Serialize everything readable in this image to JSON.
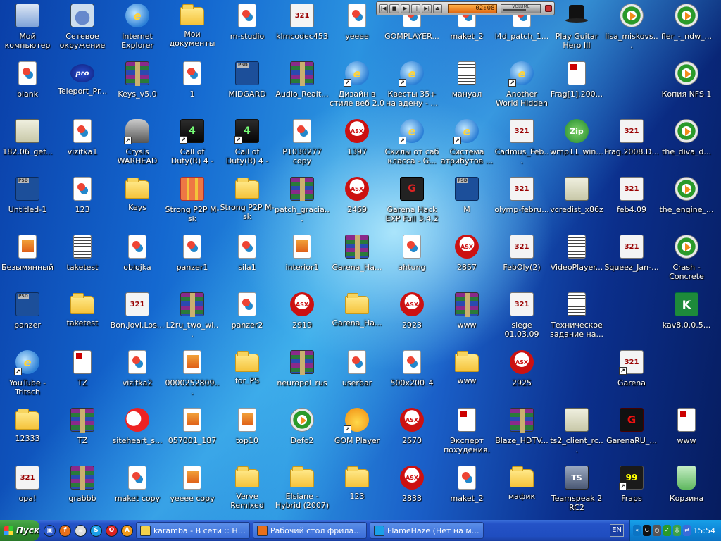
{
  "desktop": {
    "icons": [
      {
        "label": "Мой компьютер",
        "glyph": "computer",
        "icon": "my-computer-icon",
        "col": 0,
        "row": 0
      },
      {
        "label": "blank",
        "glyph": "image",
        "icon": "image-file-icon",
        "col": 0,
        "row": 1
      },
      {
        "label": "182.06_gef...",
        "glyph": "exe",
        "icon": "installer-icon",
        "col": 0,
        "row": 2
      },
      {
        "label": "Untitled-1",
        "glyph": "psd",
        "icon": "photoshop-file-icon",
        "col": 0,
        "row": 3
      },
      {
        "label": "Безымянный",
        "glyph": "photo",
        "icon": "photo-file-icon",
        "col": 0,
        "row": 4
      },
      {
        "label": "panzer",
        "glyph": "psd",
        "icon": "photoshop-file-icon",
        "col": 0,
        "row": 5
      },
      {
        "label": "YouTube - Tritsch Tratsch",
        "glyph": "web",
        "glyph_text": "e",
        "shortcut": true,
        "icon": "internet-shortcut-icon",
        "col": 0,
        "row": 6
      },
      {
        "label": "12333",
        "glyph": "folder",
        "icon": "folder-icon",
        "col": 0,
        "row": 7
      },
      {
        "label": "opa!",
        "glyph": "mpc",
        "glyph_text": "321",
        "icon": "video-file-icon",
        "col": 0,
        "row": 8
      },
      {
        "label": "Сетевое окружение",
        "glyph": "network",
        "icon": "network-places-icon",
        "col": 1,
        "row": 0
      },
      {
        "label": "Teleport_Pr...",
        "glyph": "pro",
        "glyph_text": "pro",
        "icon": "teleport-pro-icon",
        "col": 1,
        "row": 1
      },
      {
        "label": "vizitka1",
        "glyph": "image",
        "icon": "image-file-icon",
        "col": 1,
        "row": 2
      },
      {
        "label": "123",
        "glyph": "image",
        "icon": "image-file-icon",
        "col": 1,
        "row": 3
      },
      {
        "label": "taketest",
        "glyph": "text",
        "icon": "text-file-icon",
        "col": 1,
        "row": 4
      },
      {
        "label": "taketest",
        "glyph": "folder",
        "icon": "folder-icon",
        "col": 1,
        "row": 5
      },
      {
        "label": "TZ",
        "glyph": "doc",
        "icon": "document-file-icon",
        "col": 1,
        "row": 6
      },
      {
        "label": "TZ",
        "glyph": "rar",
        "icon": "rar-archive-icon",
        "col": 1,
        "row": 7
      },
      {
        "label": "grabbb",
        "glyph": "rar",
        "icon": "rar-archive-icon",
        "col": 1,
        "row": 8
      },
      {
        "label": "Internet Explorer",
        "glyph": "web",
        "glyph_text": "e",
        "icon": "internet-explorer-icon",
        "col": 2,
        "row": 0
      },
      {
        "label": "Keys_v5.0",
        "glyph": "rar",
        "icon": "rar-archive-icon",
        "col": 2,
        "row": 1
      },
      {
        "label": "Crysis WARHEAD",
        "glyph": "soldier",
        "shortcut": true,
        "icon": "game-shortcut-icon",
        "col": 2,
        "row": 2
      },
      {
        "label": "Keys",
        "glyph": "folder",
        "icon": "folder-icon",
        "col": 2,
        "row": 3
      },
      {
        "label": "oblojka",
        "glyph": "image",
        "icon": "image-file-icon",
        "col": 2,
        "row": 4
      },
      {
        "label": "Bon.Jovi.Los...",
        "glyph": "mpc",
        "glyph_text": "321",
        "icon": "video-file-icon",
        "col": 2,
        "row": 5
      },
      {
        "label": "vizitka2",
        "glyph": "image",
        "icon": "image-file-icon",
        "col": 2,
        "row": 6
      },
      {
        "label": "siteheart_s...",
        "glyph": "heart",
        "icon": "siteheart-icon",
        "col": 2,
        "row": 7
      },
      {
        "label": "maket copy",
        "glyph": "image",
        "icon": "image-file-icon",
        "col": 2,
        "row": 8
      },
      {
        "label": "Мои документы",
        "glyph": "folder",
        "icon": "my-documents-icon",
        "col": 3,
        "row": 0
      },
      {
        "label": "1",
        "glyph": "image",
        "icon": "image-file-icon",
        "col": 3,
        "row": 1
      },
      {
        "label": "Call of Duty(R) 4 - Modern ...",
        "glyph": "game",
        "glyph_text": "4",
        "shortcut": true,
        "icon": "game-shortcut-icon",
        "col": 3,
        "row": 2
      },
      {
        "label": "Strong P2P M-sk",
        "glyph": "gift",
        "icon": "strong-p2p-icon",
        "col": 3,
        "row": 3
      },
      {
        "label": "panzer1",
        "glyph": "image",
        "icon": "image-file-icon",
        "col": 3,
        "row": 4
      },
      {
        "label": "L2ru_two_wi...",
        "glyph": "rar",
        "icon": "rar-archive-icon",
        "col": 3,
        "row": 5
      },
      {
        "label": "0000252809...",
        "glyph": "photo",
        "icon": "photo-file-icon",
        "col": 3,
        "row": 6
      },
      {
        "label": "057001_187",
        "glyph": "photo",
        "icon": "photo-file-icon",
        "col": 3,
        "row": 7
      },
      {
        "label": "yeeee copy",
        "glyph": "photo",
        "icon": "photo-file-icon",
        "col": 3,
        "row": 8
      },
      {
        "label": "m-studio",
        "glyph": "image",
        "icon": "image-file-icon",
        "col": 4,
        "row": 0
      },
      {
        "label": "MIDGARD",
        "glyph": "psd",
        "icon": "photoshop-file-icon",
        "col": 4,
        "row": 1
      },
      {
        "label": "Call of Duty(R) 4 - Modern ...",
        "glyph": "game",
        "glyph_text": "4",
        "shortcut": true,
        "icon": "game-shortcut-icon",
        "col": 4,
        "row": 2
      },
      {
        "label": "Strong P2P M-sk",
        "glyph": "folder",
        "icon": "folder-icon",
        "col": 4,
        "row": 3
      },
      {
        "label": "sila1",
        "glyph": "image",
        "icon": "image-file-icon",
        "col": 4,
        "row": 4
      },
      {
        "label": "panzer2",
        "glyph": "image",
        "icon": "image-file-icon",
        "col": 4,
        "row": 5
      },
      {
        "label": "for_PS",
        "glyph": "folder",
        "icon": "folder-icon",
        "col": 4,
        "row": 6
      },
      {
        "label": "top10",
        "glyph": "photo",
        "icon": "photo-file-icon",
        "col": 4,
        "row": 7
      },
      {
        "label": "Verve Remixed",
        "glyph": "folder",
        "icon": "folder-icon",
        "col": 4,
        "row": 8
      },
      {
        "label": "klmcodec453",
        "glyph": "mpc",
        "glyph_text": "321",
        "icon": "codec-installer-icon",
        "col": 5,
        "row": 0
      },
      {
        "label": "Audio_Realt...",
        "glyph": "rar",
        "icon": "rar-archive-icon",
        "col": 5,
        "row": 1
      },
      {
        "label": "P1030277 copy",
        "glyph": "image",
        "icon": "image-file-icon",
        "col": 5,
        "row": 2
      },
      {
        "label": "patch_gracia...",
        "glyph": "rar",
        "icon": "rar-archive-icon",
        "col": 5,
        "row": 3
      },
      {
        "label": "interior1",
        "glyph": "photo",
        "icon": "photo-file-icon",
        "col": 5,
        "row": 4
      },
      {
        "label": "2919",
        "glyph": "asx",
        "glyph_text": "ASX",
        "icon": "asx-file-icon",
        "col": 5,
        "row": 5
      },
      {
        "label": "neuropol_rus",
        "glyph": "rar",
        "icon": "rar-archive-icon",
        "col": 5,
        "row": 6
      },
      {
        "label": "Defo2",
        "glyph": "media",
        "icon": "media-file-icon",
        "col": 5,
        "row": 7
      },
      {
        "label": "Elsiane - Hybrid (2007)",
        "glyph": "folder",
        "icon": "folder-icon",
        "col": 5,
        "row": 8
      },
      {
        "label": "yeeee",
        "glyph": "image",
        "icon": "image-file-icon",
        "col": 6,
        "row": 0
      },
      {
        "label": "Дизайн в стиле веб 2.0",
        "glyph": "web",
        "glyph_text": "e",
        "shortcut": true,
        "icon": "internet-shortcut-icon",
        "col": 6,
        "row": 1
      },
      {
        "label": "1397",
        "glyph": "asx",
        "glyph_text": "ASX",
        "icon": "asx-file-icon",
        "col": 6,
        "row": 2
      },
      {
        "label": "2469",
        "glyph": "asx",
        "glyph_text": "ASX",
        "icon": "asx-file-icon",
        "col": 6,
        "row": 3
      },
      {
        "label": "Garena_Ha...",
        "glyph": "rar",
        "icon": "rar-archive-icon",
        "col": 6,
        "row": 4
      },
      {
        "label": "Garena_Ha...",
        "glyph": "folder",
        "icon": "folder-icon",
        "col": 6,
        "row": 5
      },
      {
        "label": "userbar",
        "glyph": "image",
        "icon": "image-file-icon",
        "col": 6,
        "row": 6
      },
      {
        "label": "GOM Player",
        "glyph": "gom",
        "shortcut": true,
        "icon": "gom-player-icon",
        "col": 6,
        "row": 7
      },
      {
        "label": "123",
        "glyph": "folder",
        "icon": "folder-icon",
        "col": 6,
        "row": 8
      },
      {
        "label": "GOMPLAYER...",
        "glyph": "image",
        "icon": "image-file-icon",
        "col": 7,
        "row": 0
      },
      {
        "label": "Квесты 35+ на адену - ...",
        "glyph": "web",
        "glyph_text": "e",
        "shortcut": true,
        "icon": "internet-shortcut-icon",
        "col": 7,
        "row": 1
      },
      {
        "label": "Скилы от саб класса - G...",
        "glyph": "web",
        "glyph_text": "e",
        "shortcut": true,
        "icon": "internet-shortcut-icon",
        "col": 7,
        "row": 2
      },
      {
        "label": "Garena Hack EXP Full 3.4.2",
        "glyph": "red",
        "glyph_text": "G",
        "icon": "garena-hack-icon",
        "col": 7,
        "row": 3
      },
      {
        "label": "ahtung",
        "glyph": "image",
        "icon": "image-file-icon",
        "col": 7,
        "row": 4
      },
      {
        "label": "2923",
        "glyph": "asx",
        "glyph_text": "ASX",
        "icon": "asx-file-icon",
        "col": 7,
        "row": 5
      },
      {
        "label": "500x200_4",
        "glyph": "image",
        "icon": "image-file-icon",
        "col": 7,
        "row": 6
      },
      {
        "label": "2670",
        "glyph": "asx",
        "glyph_text": "ASX",
        "icon": "asx-file-icon",
        "col": 7,
        "row": 7
      },
      {
        "label": "2833",
        "glyph": "asx",
        "glyph_text": "ASX",
        "icon": "asx-file-icon",
        "col": 7,
        "row": 8
      },
      {
        "label": "maket_2",
        "glyph": "image",
        "icon": "image-file-icon",
        "col": 8,
        "row": 0
      },
      {
        "label": "мануал",
        "glyph": "text",
        "icon": "text-file-icon",
        "col": 8,
        "row": 1
      },
      {
        "label": "Система атрибутов ...",
        "glyph": "web",
        "glyph_text": "e",
        "shortcut": true,
        "icon": "internet-shortcut-icon",
        "col": 8,
        "row": 2
      },
      {
        "label": "M",
        "glyph": "psd",
        "icon": "photoshop-file-icon",
        "col": 8,
        "row": 3
      },
      {
        "label": "2857",
        "glyph": "asx",
        "glyph_text": "ASX",
        "icon": "asx-file-icon",
        "col": 8,
        "row": 4
      },
      {
        "label": "www",
        "glyph": "rar",
        "icon": "rar-archive-icon",
        "col": 8,
        "row": 5
      },
      {
        "label": "www",
        "glyph": "folder",
        "icon": "folder-icon",
        "col": 8,
        "row": 6
      },
      {
        "label": "Эксперт похудения.",
        "glyph": "doc",
        "icon": "document-file-icon",
        "col": 8,
        "row": 7
      },
      {
        "label": "maket_2",
        "glyph": "image",
        "icon": "image-file-icon",
        "col": 8,
        "row": 8
      },
      {
        "label": "l4d_patch_1...",
        "glyph": "image",
        "icon": "image-file-icon",
        "col": 9,
        "row": 0
      },
      {
        "label": "Another World Hidden Trut...",
        "glyph": "web",
        "glyph_text": "e",
        "shortcut": true,
        "icon": "internet-shortcut-icon",
        "col": 9,
        "row": 1
      },
      {
        "label": "Cadmus_Feb...",
        "glyph": "mpc",
        "glyph_text": "321",
        "icon": "video-file-icon",
        "col": 9,
        "row": 2
      },
      {
        "label": "olymp-febru...",
        "glyph": "mpc",
        "glyph_text": "321",
        "icon": "video-file-icon",
        "col": 9,
        "row": 3
      },
      {
        "label": "FebOly(2)",
        "glyph": "mpc",
        "glyph_text": "321",
        "icon": "video-file-icon",
        "col": 9,
        "row": 4
      },
      {
        "label": "siege 01.03.09",
        "glyph": "mpc",
        "glyph_text": "321",
        "icon": "video-file-icon",
        "col": 9,
        "row": 5
      },
      {
        "label": "2925",
        "glyph": "asx",
        "glyph_text": "ASX",
        "icon": "asx-file-icon",
        "col": 9,
        "row": 6
      },
      {
        "label": "Blaze_HDTV...",
        "glyph": "rar",
        "icon": "rar-archive-icon",
        "col": 9,
        "row": 7
      },
      {
        "label": "мафик",
        "glyph": "folder",
        "icon": "folder-icon",
        "col": 9,
        "row": 8
      },
      {
        "label": "Play Guitar Hero III",
        "glyph": "hat",
        "icon": "guitar-hero-icon",
        "col": 10,
        "row": 0
      },
      {
        "label": "Frag[1].200...",
        "glyph": "doc",
        "icon": "document-file-icon",
        "col": 10,
        "row": 1
      },
      {
        "label": "wmp11_win...",
        "glyph": "zip",
        "glyph_text": "Zip",
        "icon": "zip-archive-icon",
        "col": 10,
        "row": 2
      },
      {
        "label": "vcredist_x86z",
        "glyph": "exe",
        "icon": "installer-icon",
        "col": 10,
        "row": 3
      },
      {
        "label": "VideoPlayer...",
        "glyph": "text",
        "icon": "text-file-icon",
        "col": 10,
        "row": 4
      },
      {
        "label": "Техническое задание на...",
        "glyph": "text",
        "icon": "text-file-icon",
        "col": 10,
        "row": 5
      },
      {
        "label": "ts2_client_rc...",
        "glyph": "exe",
        "icon": "installer-icon",
        "col": 10,
        "row": 7
      },
      {
        "label": "Teamspeak 2 RC2",
        "glyph": "ts",
        "glyph_text": "TS",
        "icon": "teamspeak-icon",
        "col": 10,
        "row": 8
      },
      {
        "label": "lisa_miskovs...",
        "glyph": "media",
        "icon": "media-file-icon",
        "col": 11,
        "row": 0
      },
      {
        "label": "Frag.2008.D...",
        "glyph": "mpc",
        "glyph_text": "321",
        "icon": "video-file-icon",
        "col": 11,
        "row": 2
      },
      {
        "label": "feb4.09",
        "glyph": "mpc",
        "glyph_text": "321",
        "icon": "video-file-icon",
        "col": 11,
        "row": 3
      },
      {
        "label": "Squeez_Jan-...",
        "glyph": "mpc",
        "glyph_text": "321",
        "icon": "video-file-icon",
        "col": 11,
        "row": 4
      },
      {
        "label": "Garena",
        "glyph": "mpc",
        "glyph_text": "321",
        "shortcut": true,
        "icon": "garena-shortcut-icon",
        "col": 11,
        "row": 6
      },
      {
        "label": "GarenaRU_...",
        "glyph": "garena",
        "glyph_text": "G",
        "icon": "garena-icon",
        "col": 11,
        "row": 7
      },
      {
        "label": "Fraps",
        "glyph": "fraps",
        "glyph_text": "99",
        "shortcut": true,
        "icon": "fraps-icon",
        "col": 11,
        "row": 8
      },
      {
        "label": "fler_-_ndw_...",
        "glyph": "media",
        "icon": "media-file-icon",
        "col": 12,
        "row": 0
      },
      {
        "label": "Копия NFS 1",
        "glyph": "media",
        "icon": "media-file-icon",
        "col": 12,
        "row": 1
      },
      {
        "label": "the_diva_d...",
        "glyph": "media",
        "icon": "media-file-icon",
        "col": 12,
        "row": 2
      },
      {
        "label": "the_engine_...",
        "glyph": "media",
        "icon": "media-file-icon",
        "col": 12,
        "row": 3
      },
      {
        "label": "Crash - Concrete",
        "glyph": "media",
        "icon": "media-file-icon",
        "col": 12,
        "row": 4
      },
      {
        "label": "kav8.0.0.5...",
        "glyph": "kav",
        "glyph_text": "K",
        "icon": "kaspersky-icon",
        "col": 12,
        "row": 5
      },
      {
        "label": "www",
        "glyph": "doc",
        "icon": "document-file-icon",
        "col": 12,
        "row": 7
      },
      {
        "label": "Корзина",
        "glyph": "bin",
        "icon": "recycle-bin-icon",
        "col": 12,
        "row": 8
      }
    ]
  },
  "player": {
    "time": "02:08",
    "volume_label": "VOLUME",
    "volume_level": 0.6,
    "buttons": [
      "|◀",
      "■",
      "▶",
      "||",
      "▶|",
      "⏏"
    ]
  },
  "taskbar": {
    "start_label": "Пуск",
    "quick_launch": [
      {
        "icon": "desktop-icon",
        "text": "▣",
        "color": "#2a5ad0"
      },
      {
        "icon": "firefox-icon",
        "text": "f",
        "color": "#e8701a"
      },
      {
        "icon": "cup-icon",
        "text": "☕",
        "color": "#ddd"
      },
      {
        "icon": "skype-icon",
        "text": "S",
        "color": "#1aa0e8"
      },
      {
        "icon": "opera-icon",
        "text": "O",
        "color": "#d22"
      },
      {
        "icon": "avast-icon",
        "text": "A",
        "color": "#f29a1a"
      }
    ],
    "tasks": [
      {
        "label": "karamba - В сети :: Hot...",
        "icon": "karamba-icon",
        "color": "#f4d24a",
        "active": false
      },
      {
        "label": "Рабочий стол фрилансе...",
        "icon": "firefox-icon",
        "color": "#e8701a",
        "active": false
      },
      {
        "label": "FlameHaze (Нет на мест...",
        "icon": "skype-icon",
        "color": "#1aa0e8",
        "active": false
      }
    ],
    "language": "EN",
    "tray": [
      {
        "icon": "tray-expand-icon",
        "text": "«",
        "color": "#0b74c4"
      },
      {
        "icon": "garena-tray-icon",
        "text": "G",
        "color": "#111"
      },
      {
        "icon": "clock-tray-icon",
        "text": "◷",
        "color": "#555"
      },
      {
        "icon": "shield-tray-icon",
        "text": "✓",
        "color": "#2a9a2a"
      },
      {
        "icon": "users-tray-icon",
        "text": "☺",
        "color": "#3aa04a"
      },
      {
        "icon": "network-tray-icon",
        "text": "⇄",
        "color": "#3a6cd8"
      }
    ],
    "clock": "15:54"
  }
}
